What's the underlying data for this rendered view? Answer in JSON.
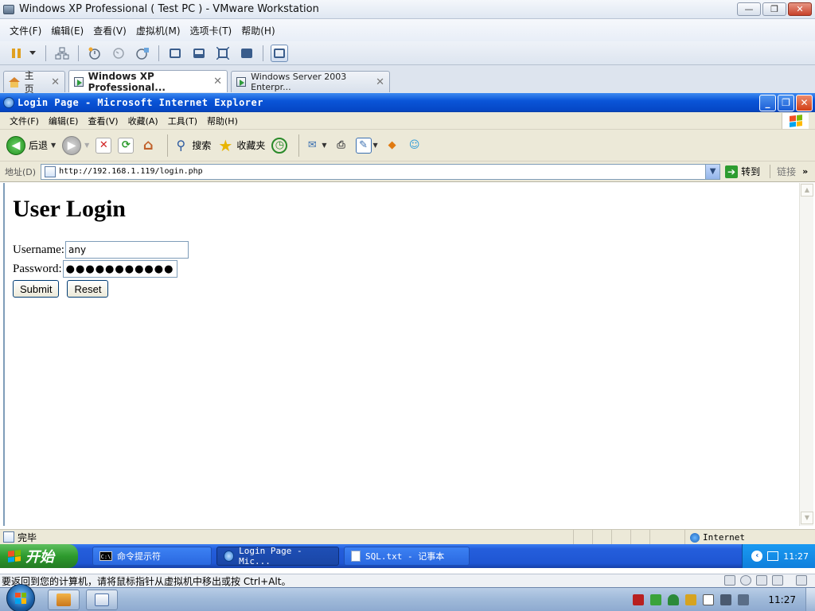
{
  "vmware": {
    "title": "Windows XP Professional ( Test PC ) - VMware Workstation",
    "menus": [
      "文件(F)",
      "编辑(E)",
      "查看(V)",
      "虚拟机(M)",
      "选项卡(T)",
      "帮助(H)"
    ],
    "window_controls": {
      "minimize": "—",
      "maximize": "❐",
      "close": "✕"
    },
    "tabs": [
      {
        "label": "主页",
        "close": "✕"
      },
      {
        "label": "Windows XP Professional...",
        "close": "✕"
      },
      {
        "label": "Windows Server 2003 Enterpr...",
        "close": "✕"
      }
    ],
    "hint": "要返回到您的计算机，请将鼠标指针从虚拟机中移出或按 Ctrl+Alt。"
  },
  "ie": {
    "title": "Login Page - Microsoft Internet Explorer",
    "menus": [
      "文件(F)",
      "编辑(E)",
      "查看(V)",
      "收藏(A)",
      "工具(T)",
      "帮助(H)"
    ],
    "toolbar": {
      "back": "后退",
      "search": "搜索",
      "favorites": "收藏夹"
    },
    "address_label": "地址(D)",
    "url": "http://192.168.1.119/login.php",
    "go": "转到",
    "links": "链接",
    "status": "完毕",
    "zone": "Internet",
    "window_controls": {
      "minimize": "_",
      "maximize": "❐",
      "close": "✕"
    }
  },
  "page": {
    "heading": "User Login",
    "username_label": "Username:",
    "username_value": "any",
    "password_label": "Password:",
    "password_value": "●●●●●●●●●●●●●●●●●",
    "submit": "Submit",
    "reset": "Reset"
  },
  "xp_taskbar": {
    "start": "开始",
    "tasks": [
      "命令提示符",
      "Login Page - Mic...",
      "SQL.txt - 记事本"
    ],
    "cmd_icon": "C:\\",
    "clock": "11:27"
  },
  "host": {
    "clock": "11:27"
  },
  "colors": {
    "xp_title_blue": "#0a55d8",
    "xp_start_green": "#2d9a2d",
    "ie_chrome": "#ece9d8"
  }
}
